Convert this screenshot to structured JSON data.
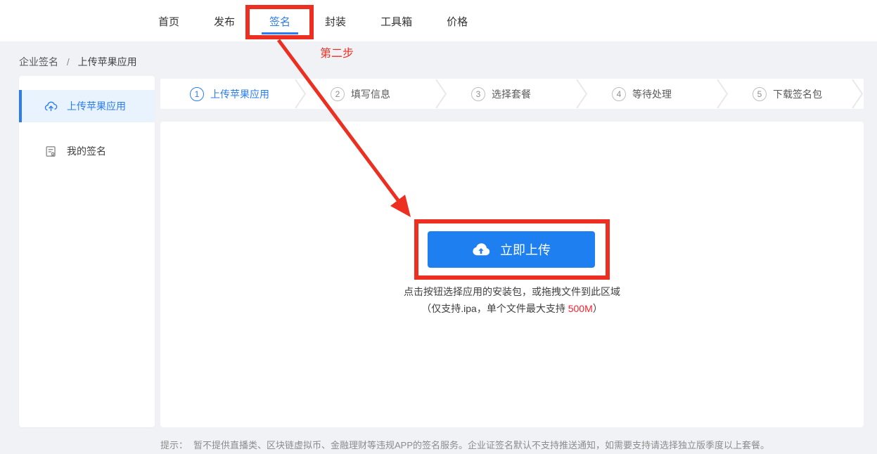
{
  "header": {
    "nav_items": [
      {
        "label": "首页"
      },
      {
        "label": "发布"
      },
      {
        "label": "签名"
      },
      {
        "label": "封装"
      },
      {
        "label": "工具箱"
      },
      {
        "label": "价格"
      }
    ],
    "active_nav": "签名"
  },
  "breadcrumb": {
    "items": [
      {
        "label": "企业签名"
      },
      {
        "label": "上传苹果应用"
      }
    ],
    "separator": "/"
  },
  "sidebar": {
    "items": [
      {
        "label": "上传苹果应用",
        "icon": "cloud-upload-icon",
        "active": true
      },
      {
        "label": "我的签名",
        "icon": "signature-document-icon",
        "active": false
      }
    ]
  },
  "wizard": {
    "steps": [
      {
        "num": "1",
        "label": "上传苹果应用",
        "active": true
      },
      {
        "num": "2",
        "label": "填写信息",
        "active": false
      },
      {
        "num": "3",
        "label": "选择套餐",
        "active": false
      },
      {
        "num": "4",
        "label": "等待处理",
        "active": false
      },
      {
        "num": "5",
        "label": "下载签名包",
        "active": false
      }
    ]
  },
  "upload": {
    "button_label": "立即上传",
    "button_icon": "cloud-upload-icon",
    "hint_line1": "点击按钮选择应用的安装包，或拖拽文件到此区域",
    "hint_line2_prefix": "（仅支持.ipa，单个文件最大支持 ",
    "hint_line2_highlight": "500M",
    "hint_line2_suffix": "）"
  },
  "footer": {
    "tip_label": "提示：",
    "tip_text": "暂不提供直播类、区块链虚拟币、金融理财等违规APP的签名服务。企业证签名默认不支持推送通知，如需要支持请选择独立版季度以上套餐。"
  },
  "annotations": {
    "step_note": "第二步"
  },
  "colors": {
    "accent_blue": "#2b7cf0",
    "button_blue": "#1e80f0",
    "annotation_red": "#ed2f21",
    "highlight_red": "#f5222d",
    "page_bg": "#f0f2f5",
    "sidebar_active_bg": "#e8f3fe"
  }
}
